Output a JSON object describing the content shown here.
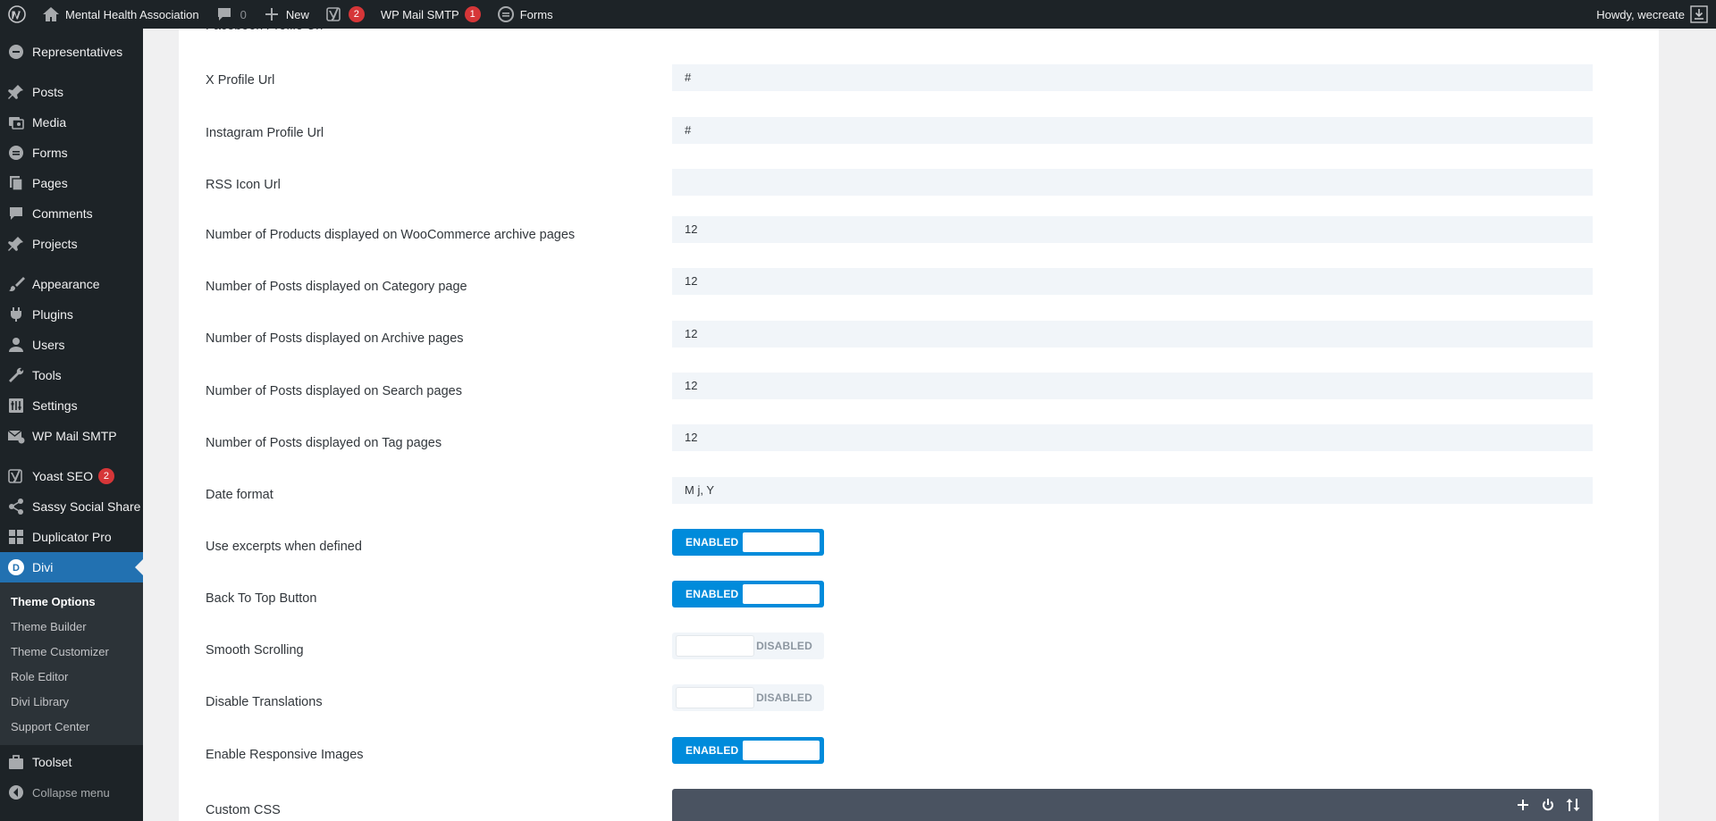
{
  "adminbar": {
    "site_name": "Mental Health Association",
    "comments_count": "0",
    "new_label": "New",
    "yoast_badge": "2",
    "wpmail_label": "WP Mail SMTP",
    "wpmail_badge": "1",
    "forms_label": "Forms",
    "howdy": "Howdy, wecreate"
  },
  "sidebar": {
    "items": [
      {
        "label": "Representatives",
        "icon": "representatives-icon"
      },
      {
        "label": "Posts",
        "icon": "pin-icon"
      },
      {
        "label": "Media",
        "icon": "media-icon"
      },
      {
        "label": "Forms",
        "icon": "forms-icon"
      },
      {
        "label": "Pages",
        "icon": "pages-icon"
      },
      {
        "label": "Comments",
        "icon": "comments-icon"
      },
      {
        "label": "Projects",
        "icon": "pin-icon"
      },
      {
        "label": "Appearance",
        "icon": "brush-icon"
      },
      {
        "label": "Plugins",
        "icon": "plugin-icon"
      },
      {
        "label": "Users",
        "icon": "users-icon"
      },
      {
        "label": "Tools",
        "icon": "wrench-icon"
      },
      {
        "label": "Settings",
        "icon": "settings-icon"
      },
      {
        "label": "WP Mail SMTP",
        "icon": "mail-icon"
      },
      {
        "label": "Yoast SEO",
        "icon": "yoast-icon",
        "badge": "2"
      },
      {
        "label": "Sassy Social Share",
        "icon": "share-icon"
      },
      {
        "label": "Duplicator Pro",
        "icon": "duplicator-icon"
      },
      {
        "label": "Divi",
        "icon": "divi-icon"
      }
    ],
    "divi_submenu": [
      "Theme Options",
      "Theme Builder",
      "Theme Customizer",
      "Role Editor",
      "Divi Library",
      "Support Center"
    ],
    "toolset": "Toolset",
    "collapse": "Collapse menu"
  },
  "settings": {
    "cut_label": "Facebook Profile Url",
    "x_label": "X Profile Url",
    "x_value": "#",
    "instagram_label": "Instagram Profile Url",
    "instagram_value": "#",
    "rss_label": "RSS Icon Url",
    "rss_value": "",
    "products_label": "Number of Products displayed on WooCommerce archive pages",
    "products_value": "12",
    "category_label": "Number of Posts displayed on Category page",
    "category_value": "12",
    "archive_label": "Number of Posts displayed on Archive pages",
    "archive_value": "12",
    "search_label": "Number of Posts displayed on Search pages",
    "search_value": "12",
    "tag_label": "Number of Posts displayed on Tag pages",
    "tag_value": "12",
    "date_label": "Date format",
    "date_value": "M j, Y",
    "excerpts_label": "Use excerpts when defined",
    "excerpts_state": "ENABLED",
    "backtotop_label": "Back To Top Button",
    "backtotop_state": "ENABLED",
    "smooth_label": "Smooth Scrolling",
    "smooth_state": "DISABLED",
    "translations_label": "Disable Translations",
    "translations_state": "DISABLED",
    "responsive_label": "Enable Responsive Images",
    "responsive_state": "ENABLED",
    "css_label": "Custom CSS"
  },
  "colors": {
    "admin_dark": "#1d2327",
    "accent_blue": "#2271b1",
    "toggle_on": "#008bdb",
    "input_bg": "#f1f5f9",
    "badge_red": "#d63638"
  }
}
